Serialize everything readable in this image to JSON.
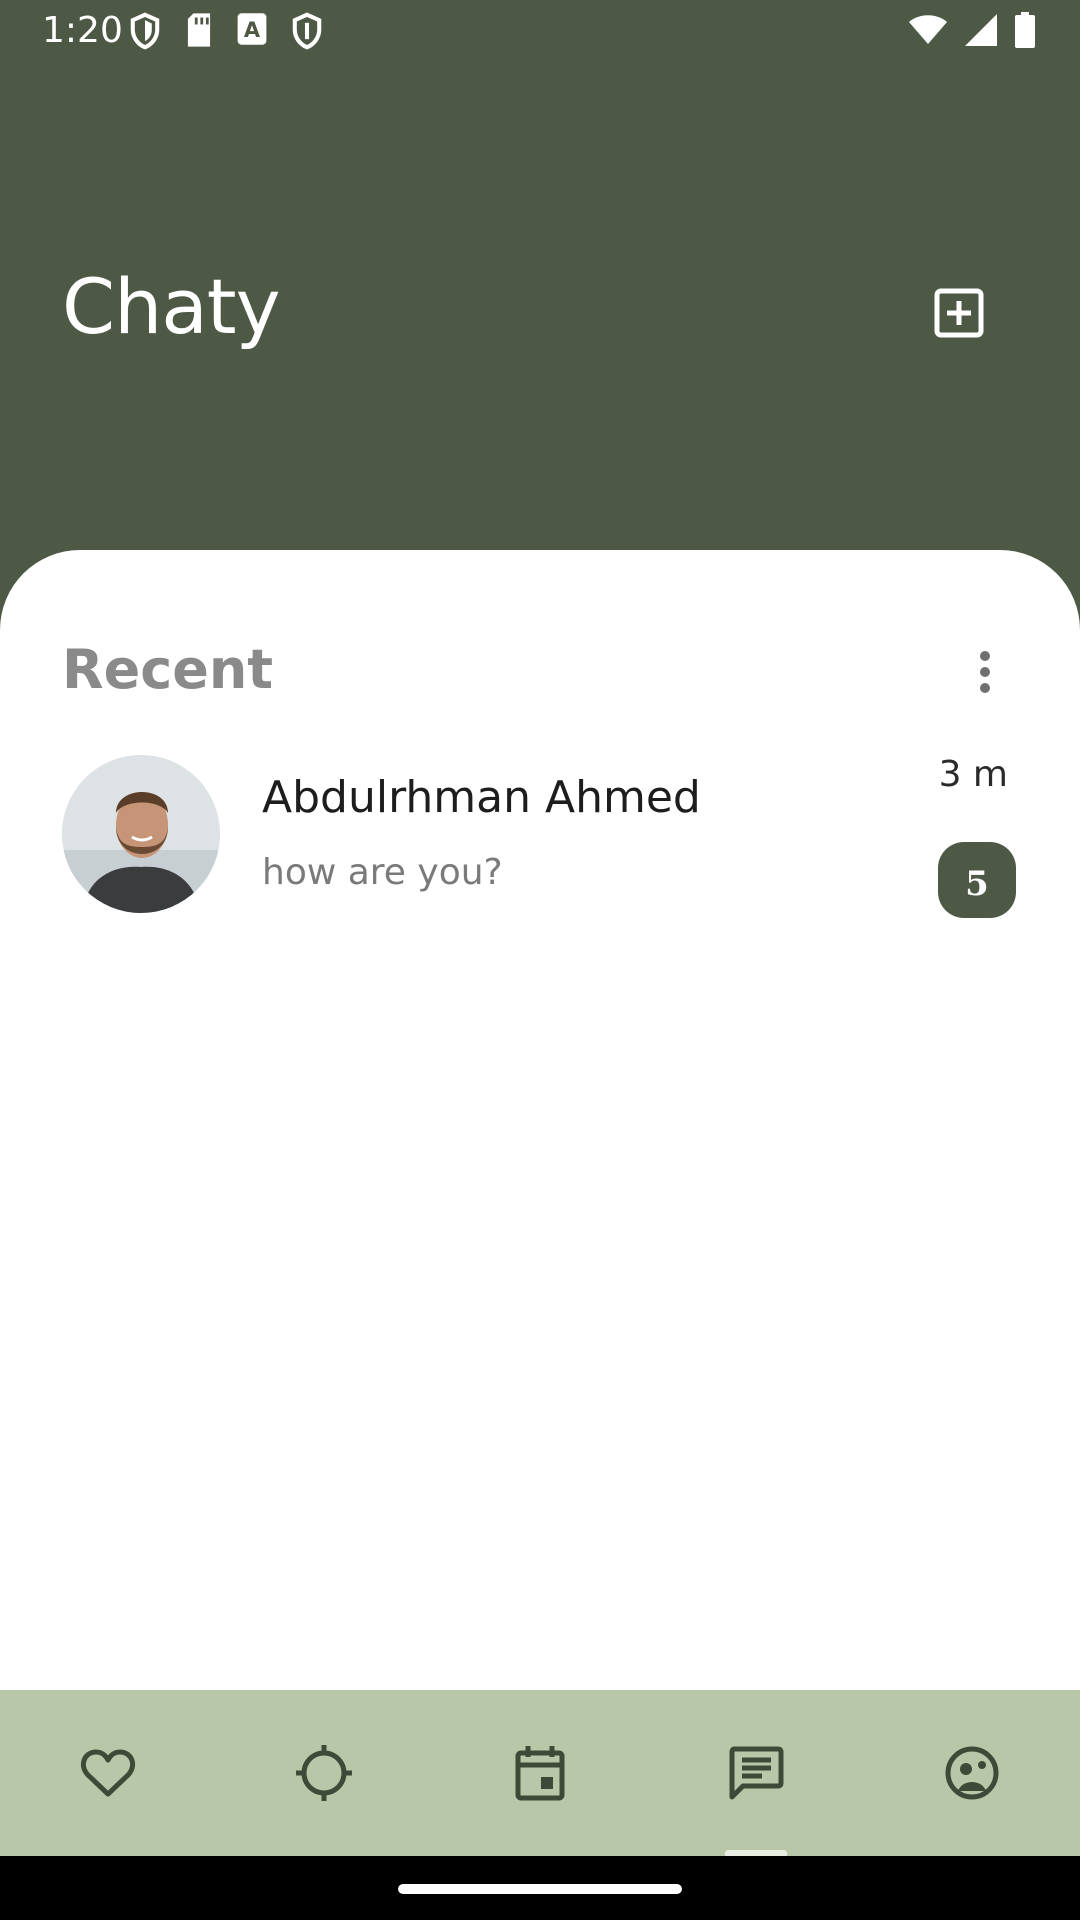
{
  "status_bar": {
    "time": "1:20",
    "left_icons": [
      "shield-icon",
      "sd-card-icon",
      "font-a-icon",
      "shield-icon"
    ],
    "right_icons": [
      "wifi-icon",
      "signal-icon",
      "battery-icon"
    ]
  },
  "header": {
    "title": "Chaty",
    "compose_icon": "add-box-icon",
    "background_color": "#4e5945"
  },
  "recent": {
    "title": "Recent",
    "menu_icon": "more-vert-icon",
    "chats": [
      {
        "name": "Abdulrhman Ahmed",
        "preview": "how are you?",
        "time": "3 m",
        "unread": "5"
      }
    ]
  },
  "bottom_nav": {
    "background_color": "#b7c7a8",
    "items": [
      {
        "icon": "heart-icon"
      },
      {
        "icon": "target-icon"
      },
      {
        "icon": "calendar-icon"
      },
      {
        "icon": "chat-icon",
        "selected": true
      },
      {
        "icon": "profile-face-icon"
      }
    ]
  }
}
